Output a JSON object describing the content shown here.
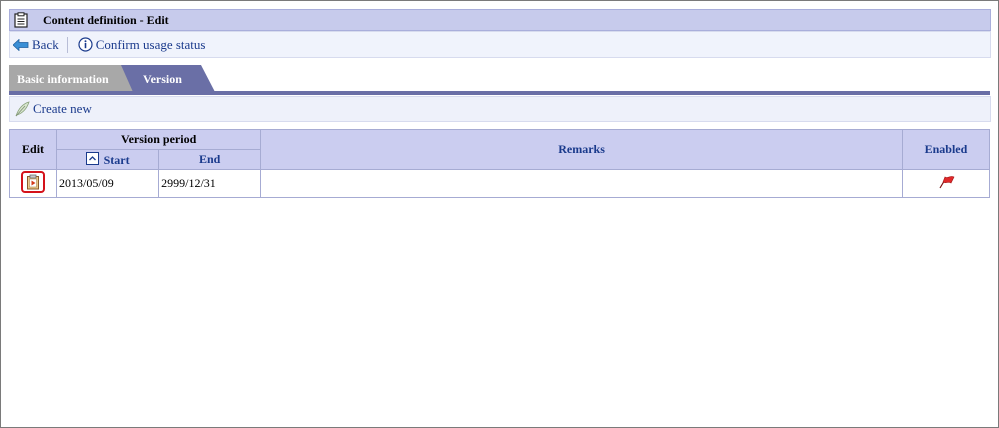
{
  "window": {
    "title": "Content definition - Edit"
  },
  "toolbar": {
    "back_label": "Back",
    "confirm_label": "Confirm usage status"
  },
  "tabs": [
    {
      "label": "Basic information",
      "active": false
    },
    {
      "label": "Version",
      "active": true
    }
  ],
  "subtoolbar": {
    "create_label": "Create new"
  },
  "table": {
    "headers": {
      "edit": "Edit",
      "version_period": "Version period",
      "start": "Start",
      "end": "End",
      "remarks": "Remarks",
      "enabled": "Enabled"
    },
    "rows": [
      {
        "start": "2013/05/09",
        "end": "2999/12/31",
        "remarks": "",
        "enabled_icon": "red-flag-icon"
      }
    ]
  },
  "colors": {
    "title_bg": "#c7cbec",
    "tab_active": "#6a6fa6",
    "tab_inactive": "#a8a8a8",
    "link": "#1a3a8c",
    "highlight": "#d4121a"
  }
}
